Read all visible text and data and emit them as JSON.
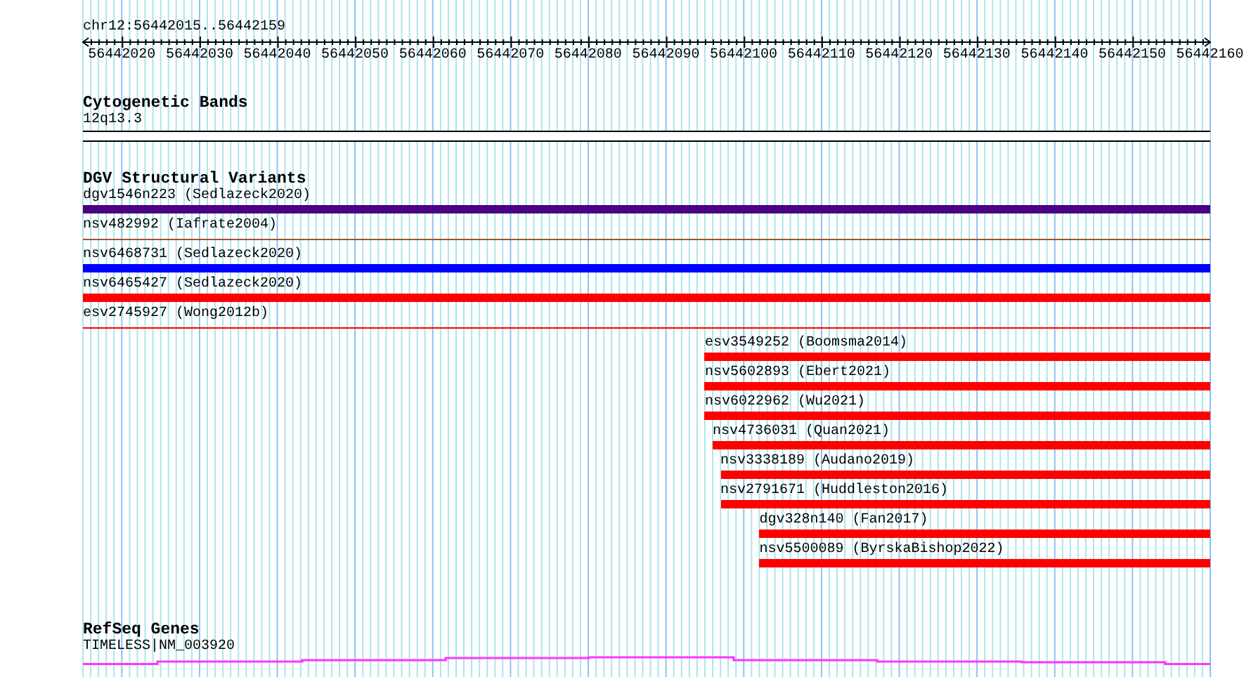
{
  "location": "chr12:56442015..56442159",
  "ruler": {
    "ticks": [
      "56442020",
      "56442030",
      "56442040",
      "56442050",
      "56442060",
      "56442070",
      "56442080",
      "56442090",
      "56442100",
      "56442110",
      "56442120",
      "56442130",
      "56442140",
      "56442150",
      "56442160"
    ]
  },
  "tracks": [
    {
      "title": "Cytogenetic Bands",
      "features": [
        {
          "label": "12q13.3",
          "kind": "band"
        }
      ]
    },
    {
      "title": "DGV Structural Variants",
      "features": [
        {
          "label": "dgv1546n223 (Sedlazeck2020)",
          "kind": "bar",
          "color": "#4b0082"
        },
        {
          "label": "nsv482992 (Iafrate2004)",
          "kind": "line",
          "color": "#a0522d"
        },
        {
          "label": "nsv6468731 (Sedlazeck2020)",
          "kind": "bar",
          "color": "#0000ff"
        },
        {
          "label": "nsv6465427 (Sedlazeck2020)",
          "kind": "bar",
          "color": "#ff0000"
        },
        {
          "label": "esv2745927 (Wong2012b)",
          "kind": "line",
          "color": "#ff0000"
        },
        {
          "label": "esv3549252 (Boomsma2014)",
          "kind": "bar",
          "color": "#ff0000"
        },
        {
          "label": "nsv5602893 (Ebert2021)",
          "kind": "bar",
          "color": "#ff0000"
        },
        {
          "label": "nsv6022962 (Wu2021)",
          "kind": "bar",
          "color": "#ff0000"
        },
        {
          "label": "nsv4736031 (Quan2021)",
          "kind": "bar",
          "color": "#ff0000"
        },
        {
          "label": "nsv3338189 (Audano2019)",
          "kind": "bar",
          "color": "#ff0000"
        },
        {
          "label": "nsv2791671 (Huddleston2016)",
          "kind": "bar",
          "color": "#ff0000"
        },
        {
          "label": "dgv328n140 (Fan2017)",
          "kind": "bar",
          "color": "#ff0000"
        },
        {
          "label": "nsv5500089 (ByrskaBishop2022)",
          "kind": "bar",
          "color": "#ff0000"
        }
      ]
    },
    {
      "title": "RefSeq Genes",
      "features": [
        {
          "label": "TIMELESS|NM_003920",
          "kind": "gene"
        }
      ]
    }
  ]
}
